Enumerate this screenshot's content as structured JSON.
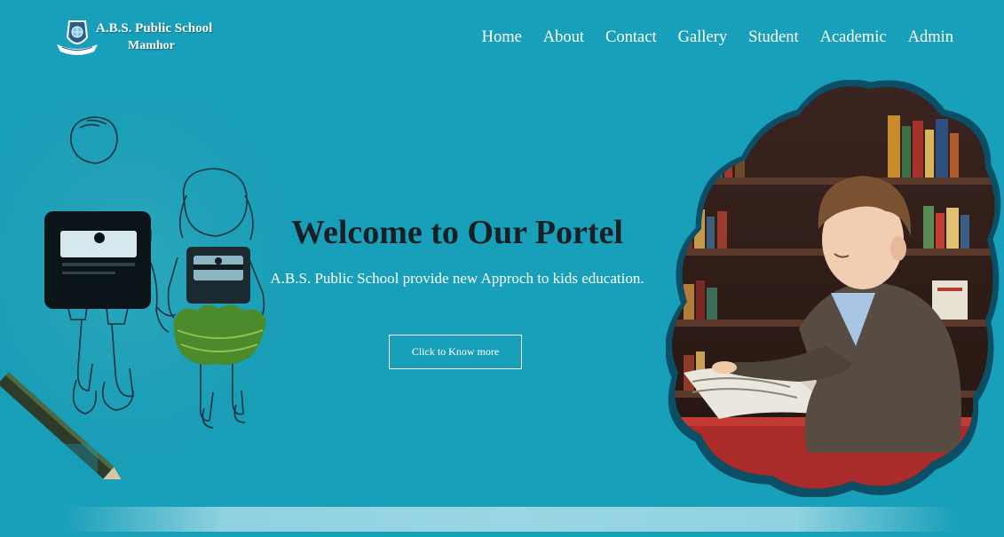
{
  "header": {
    "school_name": "A.B.S. Public School",
    "school_location": "Mamhor",
    "logo_icon": "school-crest-icon"
  },
  "nav": {
    "items": [
      {
        "label": "Home"
      },
      {
        "label": "About"
      },
      {
        "label": "Contact"
      },
      {
        "label": "Gallery"
      },
      {
        "label": "Student"
      },
      {
        "label": "Academic"
      },
      {
        "label": "Admin"
      }
    ]
  },
  "hero": {
    "title": "Welcome to Our Portel",
    "subtitle": "A.B.S. Public School provide new Approch to kids education.",
    "cta_label": "Click to Know more"
  },
  "colors": {
    "background": "#189fb9",
    "title_text": "#182025",
    "cloud_border": "#0b4f66",
    "bottom_band": "#8fd2e0"
  }
}
